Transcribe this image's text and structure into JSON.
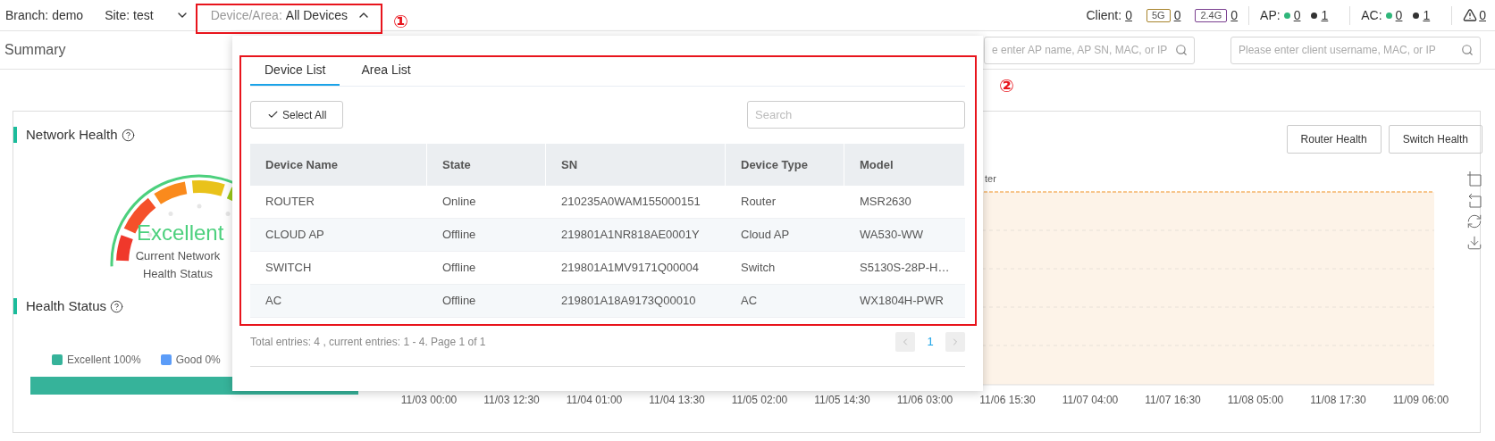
{
  "top_bar": {
    "branch": "Branch: demo",
    "site": "Site: test",
    "device_area": {
      "label": "Device/Area:",
      "value": "All Devices",
      "expanded": true
    },
    "client": {
      "label": "Client:",
      "count": "0",
      "bands": [
        {
          "label": "5G",
          "count": "0",
          "color": "#a8842c"
        },
        {
          "label": "2.4G",
          "count": "0",
          "color": "#7a3f8f"
        }
      ]
    },
    "ap": {
      "label": "AP:",
      "online": "0",
      "offline": "1"
    },
    "ac": {
      "label": "AC:",
      "online": "0",
      "offline": "1"
    },
    "alarms": "0"
  },
  "summary": {
    "title": "Summary",
    "ap_search": {
      "placeholder": "e enter AP name, AP SN, MAC, or IP"
    },
    "client_search": {
      "placeholder": "Please enter client username, MAC, or IP"
    }
  },
  "network_health": {
    "title": "Network Health",
    "rating": "Excellent",
    "caption": "Current Network Health Status"
  },
  "health_status": {
    "title": "Health Status",
    "legend": [
      {
        "label": "Excellent 100%",
        "color": "#36b39a"
      },
      {
        "label": "Good 0%",
        "color": "#5b9cf8"
      }
    ],
    "bar": {
      "level": 1
    }
  },
  "chart": {
    "buttons": [
      "Router Health",
      "Switch Health"
    ],
    "legend_fragment": "ter",
    "x_labels": [
      "11/03 00:00",
      "11/03 12:30",
      "11/04 01:00",
      "11/04 13:30",
      "11/05 02:00",
      "11/05 14:30",
      "11/06 03:00",
      "11/06 15:30",
      "11/07 04:00",
      "11/07 16:30",
      "11/08 05:00",
      "11/08 17:30",
      "11/09 06:00"
    ]
  },
  "dropdown": {
    "tabs": [
      {
        "label": "Device List",
        "selected": true
      },
      {
        "label": "Area List",
        "selected": false
      }
    ],
    "select_all": "Select All",
    "search": {
      "placeholder": "Search"
    },
    "table": {
      "columns": [
        "Device Name",
        "State",
        "SN",
        "Device Type",
        "Model"
      ],
      "rows": [
        [
          "ROUTER",
          "Online",
          "210235A0WAM155000151",
          "Router",
          "MSR2630"
        ],
        [
          "CLOUD AP",
          "Offline",
          "219801A1NR818AE0001Y",
          "Cloud AP",
          "WA530-WW"
        ],
        [
          "SWITCH",
          "Offline",
          "219801A1MV9171Q00004",
          "Switch",
          "S5130S-28P-H…"
        ],
        [
          "AC",
          "Offline",
          "219801A18A9173Q00010",
          "AC",
          "WX1804H-PWR"
        ]
      ]
    },
    "footer": "Total entries: 4 , current entries: 1 - 4. Page 1 of 1",
    "pages": [
      {
        "label": "1",
        "selected": true
      }
    ]
  },
  "annotations": [
    {
      "label": "①"
    },
    {
      "label": "②"
    }
  ]
}
